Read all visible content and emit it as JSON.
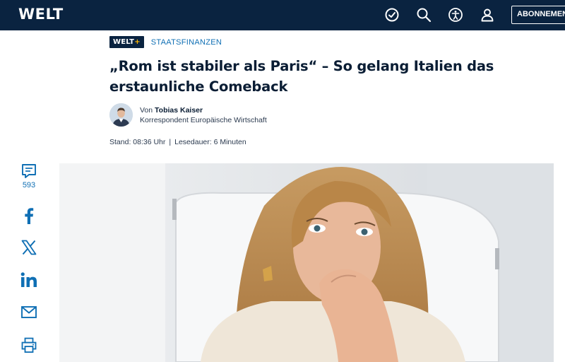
{
  "header": {
    "logo": "WELT",
    "icons": [
      "history-icon",
      "search-icon",
      "accessibility-icon",
      "user-icon"
    ],
    "subscribe_label": "ABONNEMENT"
  },
  "article": {
    "badge": {
      "text": "WELT",
      "plus": "+"
    },
    "kicker": "STAATSFINANZEN",
    "headline": "„Rom ist stabiler als Paris“ – So gelang Italien das erstaunliche Comeback",
    "author": {
      "prefix": "Von",
      "name": "Tobias Kaiser",
      "role": "Korrespondent Europäische Wirtschaft"
    },
    "stand": "Stand: 08:36 Uhr",
    "separator": "|",
    "read_time": "Lesedauer: 6 Minuten"
  },
  "share": {
    "comment_count": "593",
    "items": [
      "comment-icon",
      "facebook-icon",
      "x-icon",
      "linkedin-icon",
      "mail-icon",
      "print-icon"
    ]
  },
  "colors": {
    "header_bg": "#0a2340",
    "accent_blue": "#0f6fb4",
    "plus_yellow": "#ffb400",
    "text_dark": "#0a1d34"
  }
}
